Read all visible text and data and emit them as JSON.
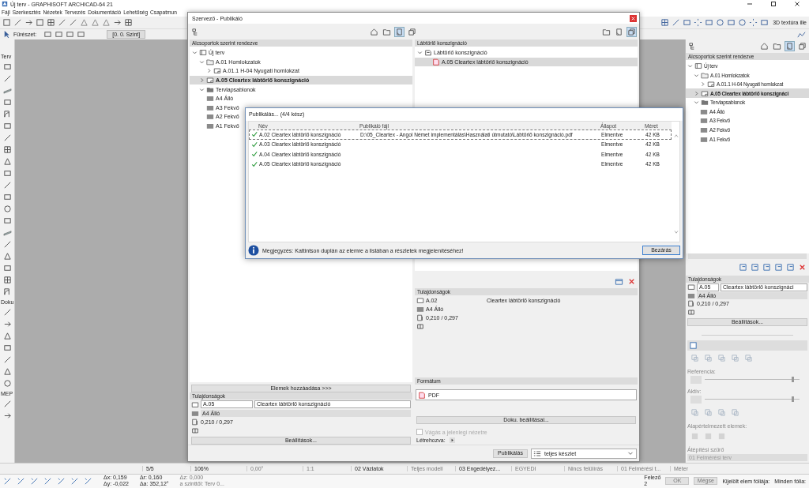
{
  "window": {
    "title": "Új terv - GRAPHISOFT ARCHICAD-64 21"
  },
  "menu": [
    "Fájl",
    "Szerkesztés",
    "Nézetek",
    "Tervezés",
    "Dokumentáció",
    "Lehetőség",
    "Csapatmun"
  ],
  "toolbar": {
    "right_label": "3D textúra ille"
  },
  "info_box": {
    "label": "Fűrészet:"
  },
  "view_tab": "[0. 0. Szint]",
  "toolbox_sections": [
    "Terv",
    "Doku",
    "MEP"
  ],
  "organizer": {
    "title": "Szervező - Publikáló",
    "left_header": "Alcsoportok szerint rendezve",
    "left_tree": [
      {
        "label": "Új terv",
        "kind": "project",
        "expanded": true,
        "selected": false,
        "children": [
          {
            "label": "A.01 Homlokzatok",
            "kind": "folder",
            "expanded": true,
            "selected": false,
            "children": [
              {
                "label": "A.01.1 H-04 Nyugati homlokzat",
                "kind": "layout",
                "expanded": false,
                "selected": false
              }
            ]
          },
          {
            "label": "A.05 Cleartex lábtörlő konszignáció",
            "kind": "layout",
            "expanded": false,
            "selected": true
          },
          {
            "label": "Tervlapsablonok",
            "kind": "masters",
            "expanded": true,
            "selected": false,
            "children": [
              {
                "label": "A4 Álló",
                "kind": "master",
                "selected": false
              },
              {
                "label": "A3 Fekvő",
                "kind": "master",
                "selected": false
              },
              {
                "label": "A2 Fekvő",
                "kind": "master",
                "selected": false
              },
              {
                "label": "A1 Fekvő",
                "kind": "master",
                "selected": false
              }
            ]
          }
        ]
      }
    ],
    "add_button": "Elemek hozzáadása >>>",
    "left_properties": {
      "header": "Tulajdonságok",
      "id": "A.05",
      "name": "Cleartex lábtörlő konszignáció",
      "master": "A4 Álló",
      "size": "0,210 / 0,297",
      "settings_button": "Beállítások..."
    },
    "right_header": "Lábtörlő konszignáció",
    "right_tree": [
      {
        "label": "Lábtörlő konszignáció",
        "kind": "set",
        "expanded": true,
        "selected": false,
        "children": [
          {
            "label": "A.05 Cleartex lábtörlő konszignáció",
            "kind": "pdf",
            "selected": true
          }
        ]
      }
    ],
    "right_properties": {
      "header": "Tulajdonságok",
      "id": "A.02",
      "name": "Cleartex lábtörlő konszignáció",
      "master": "A4 Álló",
      "size": "0,210 / 0,297"
    },
    "format": {
      "header": "Formátum",
      "value": "PDF",
      "settings_button": "Doku. beállításai...",
      "crop_checkbox": {
        "label": "Vágás a jelenlegi nézetre",
        "checked": false,
        "disabled": true
      },
      "created_label": "Létrehozva:"
    },
    "publish_button": "Publikálás",
    "set_select": "teljes készlet"
  },
  "publish_dialog": {
    "title": "Publikálás... (4/4 kész)",
    "columns": [
      "Név",
      "Publikáló fájl",
      "Állapot",
      "Méret"
    ],
    "rows": [
      {
        "name": "A.02 Cleartex lábtörlő konszignáció",
        "file": "D:\\05_Cleartex - Angol Német implementálás\\Használati útmutató\\Lábtörlő konszignáció.pdf",
        "status": "Elmentve",
        "size": "42 KB",
        "done": true,
        "selected": true
      },
      {
        "name": "A.03 Cleartex lábtörlő konszignáció",
        "status": "Elmentve",
        "size": "42 KB",
        "done": true,
        "selected": false
      },
      {
        "name": "A.04 Cleartex lábtörlő konszignáció",
        "status": "Elmentve",
        "size": "42 KB",
        "done": true,
        "selected": false
      },
      {
        "name": "A.05 Cleartex lábtörlő konszignáció",
        "status": "Elmentve",
        "size": "42 KB",
        "done": true,
        "selected": false
      }
    ],
    "note": "Megjegyzés: Kattintson duplán az elemre a listában a részletek megjelenítéséhez!",
    "close_button": "Bezárás"
  },
  "navigator": {
    "header": "Alcsoportok szerint rendezve",
    "tree": [
      {
        "label": "Új terv",
        "kind": "project",
        "expanded": true,
        "selected": false,
        "children": [
          {
            "label": "A.01 Homlokzatok",
            "kind": "folder",
            "expanded": true,
            "selected": false,
            "children": [
              {
                "label": "A.01.1 H-04 Nyugati homlokzat",
                "kind": "layout",
                "expanded": false,
                "selected": false
              }
            ]
          },
          {
            "label": "A.05 Cleartex lábtörlő konszignáci",
            "kind": "layout",
            "expanded": false,
            "selected": true
          },
          {
            "label": "Tervlapsablonok",
            "kind": "masters",
            "expanded": true,
            "selected": false,
            "children": [
              {
                "label": "A4 Álló",
                "kind": "master",
                "selected": false
              },
              {
                "label": "A3 Fekvő",
                "kind": "master",
                "selected": false
              },
              {
                "label": "A2 Fekvő",
                "kind": "master",
                "selected": false
              },
              {
                "label": "A1 Fekvő",
                "kind": "master",
                "selected": false
              }
            ]
          }
        ]
      }
    ],
    "properties": {
      "header": "Tulajdonságok",
      "id": "A.05",
      "name": "Cleartex lábtörlő konszignáci",
      "master": "A4 Álló",
      "size": "0,210 / 0,297",
      "settings_button": "Beállítások..."
    },
    "reference_label": "Referencia:",
    "reference_slider": {
      "level": 0.92
    },
    "active_label": "Aktív:",
    "active_slider": {
      "level": 0.92
    },
    "defaults_label": "Alapértelmezett elemek:",
    "filter_label": "Átépítési szűrő",
    "filter_value": "01 Felmérési terv"
  },
  "status_bar": {
    "page": "5/5",
    "zoom": "106%",
    "angle": "0,00°",
    "scale": "1:1",
    "layer_combo": "02 Vázlatok",
    "model_view": "Teljes modell",
    "pen_set": "03 Engedélyez...",
    "dimension": "EGYEDI",
    "override": "Nincs felülírás",
    "renovation": "01 Felmérési t...",
    "unit": "Méter"
  },
  "coordinate_bar": {
    "dx": "Δx: 0,159",
    "dy": "Δy: -0,022",
    "dr": "Δr: 0,160",
    "da": "Δa: 352,12°",
    "dz": "Δz: 0,000",
    "level": "a szinttől: Terv 0...",
    "snap": "Felező",
    "snap_count": "2",
    "ok": "OK",
    "cancel": "Mégse",
    "element_layer": "Kijelölt elem fóliája:",
    "all_layers": "Minden fólia:"
  }
}
